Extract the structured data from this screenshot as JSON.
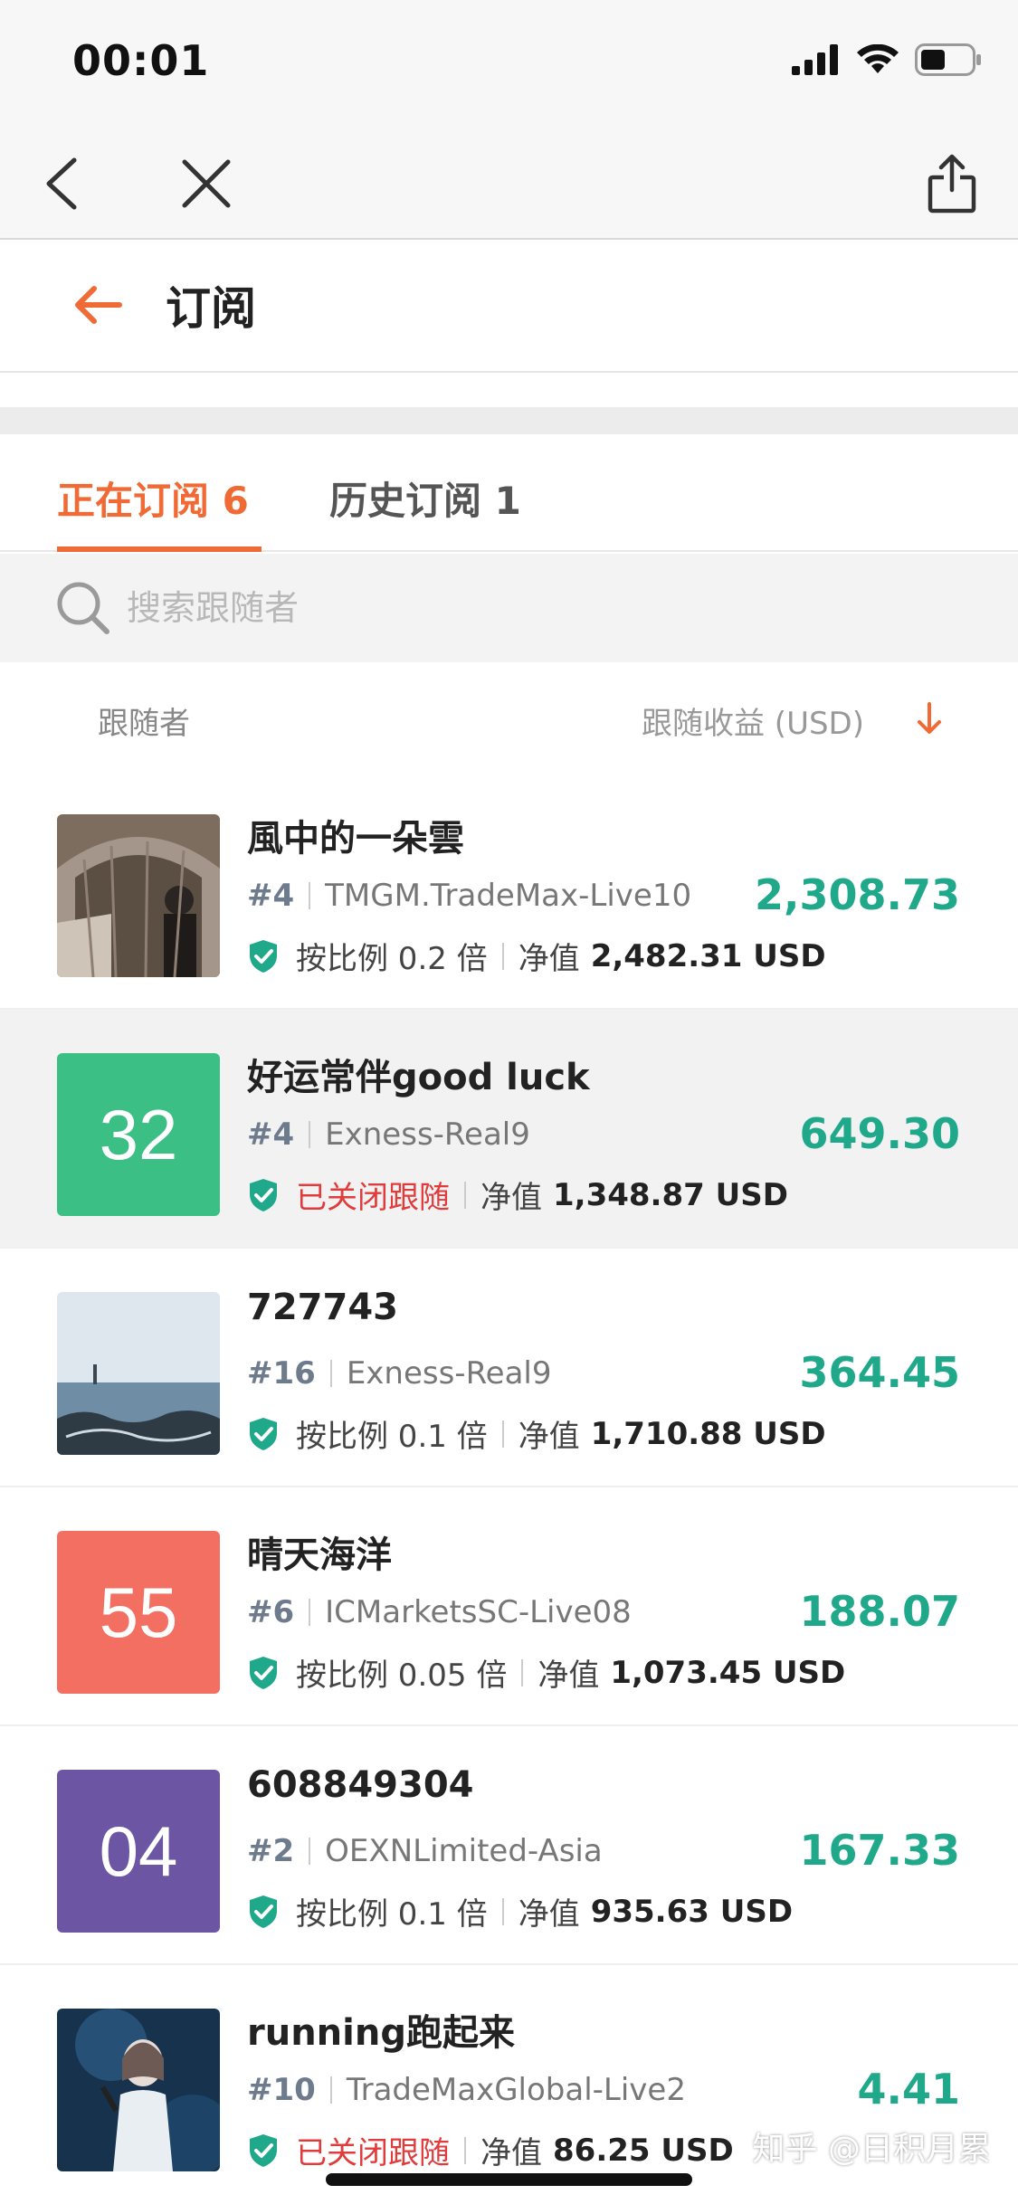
{
  "status": {
    "time": "00:01"
  },
  "header": {
    "title": "订阅"
  },
  "tabs": [
    {
      "label": "正在订阅 6"
    },
    {
      "label": "历史订阅 1"
    }
  ],
  "search": {
    "placeholder": "搜索跟随者"
  },
  "columns": {
    "left": "跟随者",
    "right": "跟随收益 (USD)"
  },
  "net_label": "净值",
  "followers": [
    {
      "name": "風中的一朵雲",
      "rank": "#4",
      "server": "TMGM.TradeMax-Live10",
      "status": "按比例 0.2 倍",
      "net": "2,482.31 USD",
      "profit": "2,308.73",
      "avatar_text": "",
      "avatar_color": "#8a7a6a"
    },
    {
      "name": "好运常伴good luck",
      "rank": "#4",
      "server": "Exness-Real9",
      "status": "已关闭跟随",
      "net": "1,348.87 USD",
      "profit": "649.30",
      "avatar_text": "32",
      "avatar_color": "#3cbf85"
    },
    {
      "name": "727743",
      "rank": "#16",
      "server": "Exness-Real9",
      "status": "按比例 0.1 倍",
      "net": "1,710.88 USD",
      "profit": "364.45",
      "avatar_text": "",
      "avatar_color": "#9fb4c6"
    },
    {
      "name": "晴天海洋",
      "rank": "#6",
      "server": "ICMarketsSC-Live08",
      "status": "按比例 0.05 倍",
      "net": "1,073.45 USD",
      "profit": "188.07",
      "avatar_text": "55",
      "avatar_color": "#f26f61"
    },
    {
      "name": "608849304",
      "rank": "#2",
      "server": "OEXNLimited-Asia",
      "status": "按比例 0.1 倍",
      "net": "935.63 USD",
      "profit": "167.33",
      "avatar_text": "04",
      "avatar_color": "#6c56a3"
    },
    {
      "name": "running跑起来",
      "rank": "#10",
      "server": "TradeMaxGlobal-Live2",
      "status": "已关闭跟随",
      "net": "86.25 USD",
      "profit": "4.41",
      "avatar_text": "",
      "avatar_color": "#1a3a5a"
    }
  ],
  "watermark": "知乎 @日积月累",
  "colors": {
    "accent": "#f06a35",
    "profit": "#1fa98a",
    "closed": "#e03c3c"
  }
}
